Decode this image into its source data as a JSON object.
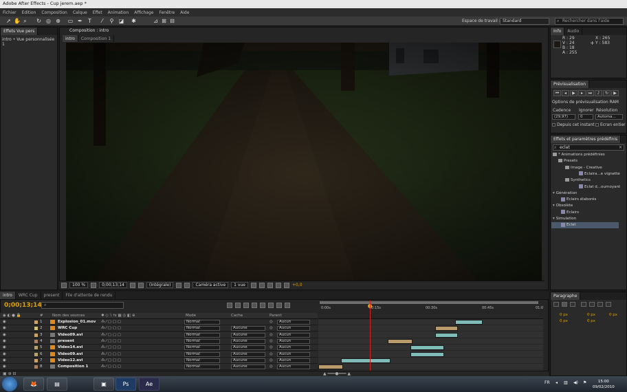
{
  "window": {
    "title": "Adobe After Effects - Cup jerem.aep *"
  },
  "menu": [
    "Fichier",
    "Edition",
    "Composition",
    "Calque",
    "Effet",
    "Animation",
    "Affichage",
    "Fenêtre",
    "Aide"
  ],
  "toolbar": {
    "workspace_label": "Espace de travail :",
    "workspace_value": "Standard",
    "search_placeholder": "Rechercher dans l'aide"
  },
  "project_panel": {
    "tab": "Effets Vue pers",
    "subtitle": "intro • Vue personnalisée 1"
  },
  "composition": {
    "panel_title": "Composition : intro",
    "tabs": [
      "intro",
      "Composition 1"
    ]
  },
  "viewer_bar": {
    "zoom": "100 %",
    "time": "0;00;13;14",
    "resolution": "(Intégrale)",
    "camera": "Caméra active",
    "view": "1 vue",
    "exposure": "+0,0"
  },
  "info_panel": {
    "tabs": [
      "Info",
      "Audio"
    ],
    "r": "R : 29",
    "g": "V : 24",
    "b": "B : 18",
    "a": "A : 255",
    "x": "X : 265",
    "y": "Y : 583",
    "swatch_color": "#1d1812"
  },
  "preview_panel": {
    "title": "Prévisualisation",
    "ram_options": "Options de prévisualisation RAM",
    "frame_rate_label": "Cadence",
    "skip_label": "Ignorer",
    "resolution_label": "Résolution",
    "frame_rate_value": "(29,97)",
    "skip_value": "0",
    "resolution_value": "Automa...",
    "from_current": "Depuis cet instant",
    "full_screen": "Ecran entier"
  },
  "effects_panel": {
    "title": "Effets et paramètres prédéfinis",
    "search_value": "eclat",
    "tree": [
      {
        "label": "* Animations prédéfinies",
        "type": "folder"
      },
      {
        "label": "Presets",
        "type": "folder"
      },
      {
        "label": "Image - Creative",
        "type": "folder"
      },
      {
        "label": "Eclaira...e vignette",
        "type": "fx"
      },
      {
        "label": "Synthetics",
        "type": "folder"
      },
      {
        "label": "Eclat d...ournoyant",
        "type": "fx"
      },
      {
        "label": "Génération",
        "type": "category"
      },
      {
        "label": "Eclairs élaborés",
        "type": "fx"
      },
      {
        "label": "Obsolète",
        "type": "category"
      },
      {
        "label": "Eclairs",
        "type": "fx"
      },
      {
        "label": "Simulation",
        "type": "category"
      },
      {
        "label": "Eclat",
        "type": "fx",
        "selected": true
      }
    ]
  },
  "timeline": {
    "tabs": [
      "intro",
      "WRC Cup",
      "present",
      "File d'attente de rendu"
    ],
    "current_time": "0;00;13;14",
    "search_placeholder": "",
    "columns": {
      "num": "#",
      "source": "Nom des sources",
      "mode": "Mode",
      "cache": "Cache",
      "parent": "Parent"
    },
    "ruler_ticks": [
      "0:00s",
      "00:15s",
      "00:30s",
      "00:45s",
      "01:0"
    ],
    "current_time_fraction": 0.23,
    "layers": [
      {
        "num": "1",
        "name": "Explosion_01.mov",
        "label_color": "#c9a36a",
        "icon": "vlc",
        "mode": "Normal",
        "cache": "",
        "parent": "Aucun",
        "bar_start": 0.61,
        "bar_end": 0.73,
        "bar_color": "#7fbcb8"
      },
      {
        "num": "2",
        "name": "WRC Cup",
        "label_color": "#d3c37a",
        "icon": "vlc",
        "mode": "Normal",
        "cache": "Aucune",
        "parent": "Aucun",
        "bar_start": 0.52,
        "bar_end": 0.62,
        "bar_color": "#b89a6c"
      },
      {
        "num": "3",
        "name": "Video09.avi",
        "label_color": "#c9a36a",
        "icon": "footage",
        "mode": "Normal",
        "cache": "Aucune",
        "parent": "Aucun",
        "bar_start": 0.52,
        "bar_end": 0.62,
        "bar_color": "#7fbcb8"
      },
      {
        "num": "4",
        "name": "present",
        "label_color": "#a88064",
        "icon": "comp",
        "mode": "Normal",
        "cache": "Aucune",
        "parent": "Aucun",
        "bar_start": 0.31,
        "bar_end": 0.42,
        "bar_color": "#b89a6c"
      },
      {
        "num": "5",
        "name": "Video14.avi",
        "label_color": "#b9a26c",
        "icon": "vlc",
        "mode": "Normal",
        "cache": "Aucune",
        "parent": "Aucun",
        "bar_start": 0.41,
        "bar_end": 0.56,
        "bar_color": "#7fbcb8"
      },
      {
        "num": "6",
        "name": "Video09.avi",
        "label_color": "#b9a26c",
        "icon": "vlc",
        "mode": "Normal",
        "cache": "Aucune",
        "parent": "Aucun",
        "bar_start": 0.41,
        "bar_end": 0.56,
        "bar_color": "#7fbcb8"
      },
      {
        "num": "7",
        "name": "Video12.avi",
        "label_color": "#c9a36a",
        "icon": "vlc",
        "mode": "Normal",
        "cache": "Aucune",
        "parent": "Aucun",
        "bar_start": 0.1,
        "bar_end": 0.32,
        "bar_color": "#7fbcb8"
      },
      {
        "num": "8",
        "name": "Composition 1",
        "label_color": "#a88064",
        "icon": "comp",
        "mode": "Normal",
        "cache": "Aucune",
        "parent": "Aucun",
        "bar_start": 0.0,
        "bar_end": 0.11,
        "bar_color": "#b89a6c"
      }
    ]
  },
  "paragraph_panel": {
    "title": "Paragraphe",
    "fields": [
      "0 px",
      "0 px",
      "0 px",
      "0 px",
      "0 px"
    ]
  },
  "taskbar": {
    "apps": [
      "firefox-icon",
      "folder-icon",
      "app-icon",
      "photoshop-icon",
      "aftereffects-icon"
    ],
    "ps_label": "Ps",
    "ae_label": "Ae",
    "language": "FR",
    "time": "15:00",
    "date": "09/02/2010"
  }
}
